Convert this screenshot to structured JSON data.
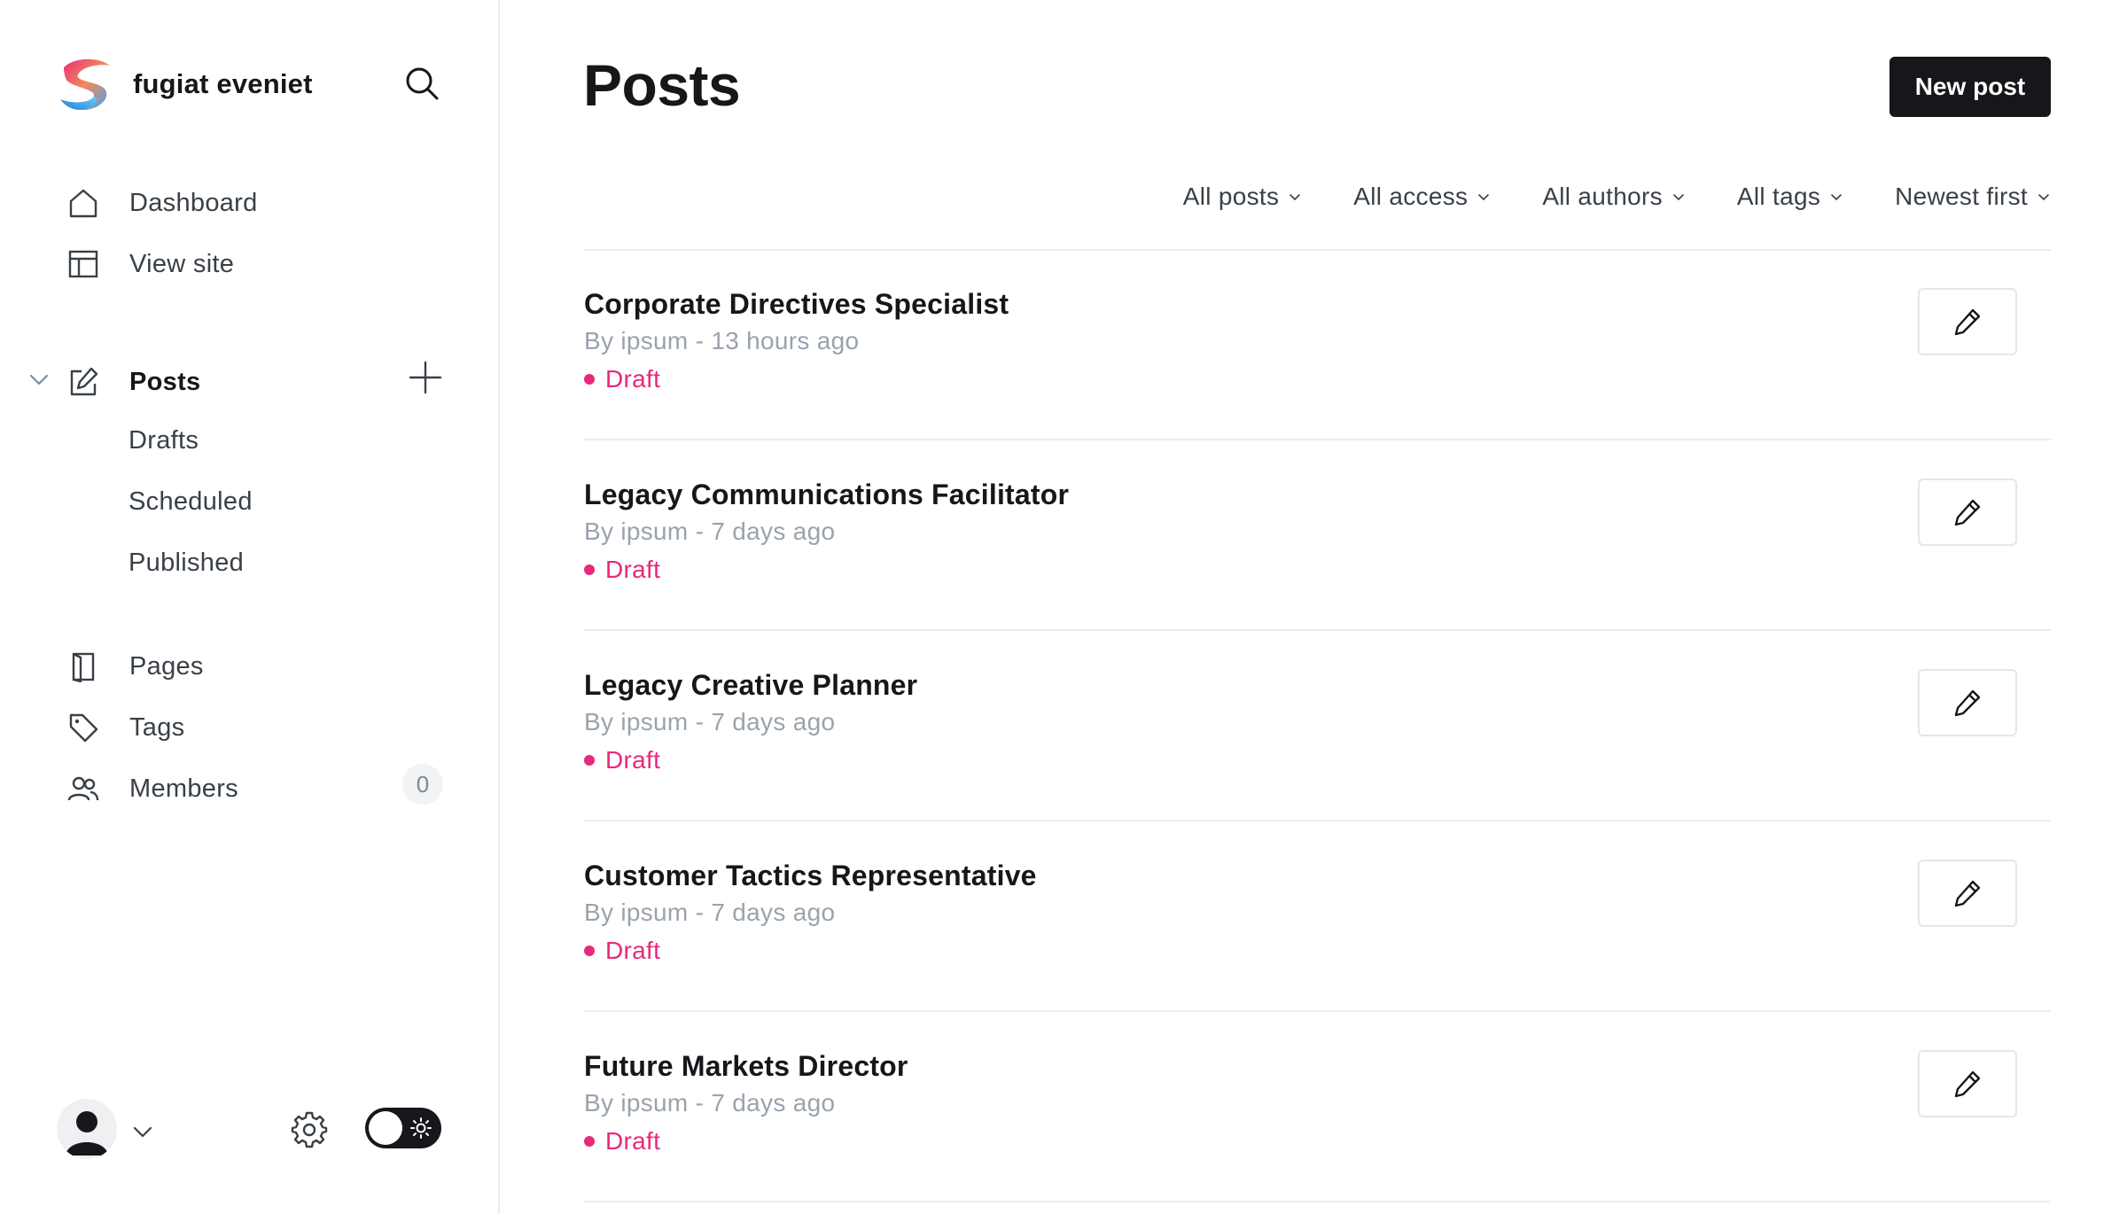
{
  "sidebar": {
    "brand_name": "fugiat eveniet",
    "nav": {
      "dashboard": "Dashboard",
      "view_site": "View site",
      "posts": "Posts",
      "drafts": "Drafts",
      "scheduled": "Scheduled",
      "published": "Published",
      "pages": "Pages",
      "tags": "Tags",
      "members": "Members",
      "members_count": "0"
    }
  },
  "header": {
    "title": "Posts",
    "new_post_label": "New post"
  },
  "filters": [
    {
      "label": "All posts"
    },
    {
      "label": "All access"
    },
    {
      "label": "All authors"
    },
    {
      "label": "All tags"
    },
    {
      "label": "Newest first"
    }
  ],
  "posts": [
    {
      "title": "Corporate Directives Specialist",
      "meta": "By ipsum - 13 hours ago",
      "status": "Draft"
    },
    {
      "title": "Legacy Communications Facilitator",
      "meta": "By ipsum - 7 days ago",
      "status": "Draft"
    },
    {
      "title": "Legacy Creative Planner",
      "meta": "By ipsum - 7 days ago",
      "status": "Draft"
    },
    {
      "title": "Customer Tactics Representative",
      "meta": "By ipsum - 7 days ago",
      "status": "Draft"
    },
    {
      "title": "Future Markets Director",
      "meta": "By ipsum - 7 days ago",
      "status": "Draft"
    }
  ],
  "colors": {
    "accent_dark": "#15171a",
    "draft_status": "#e8287c",
    "muted_text": "#99a3ad",
    "divider": "#ebeef0"
  },
  "icons": {
    "brand": "ghost-logo-icon",
    "search": "search-icon",
    "dashboard": "home-icon",
    "view_site": "layout-icon",
    "posts": "edit-icon",
    "pages": "page-icon",
    "tags": "tag-icon",
    "members": "users-icon",
    "settings": "gear-icon",
    "theme": "sun-icon",
    "edit": "pencil-icon"
  }
}
